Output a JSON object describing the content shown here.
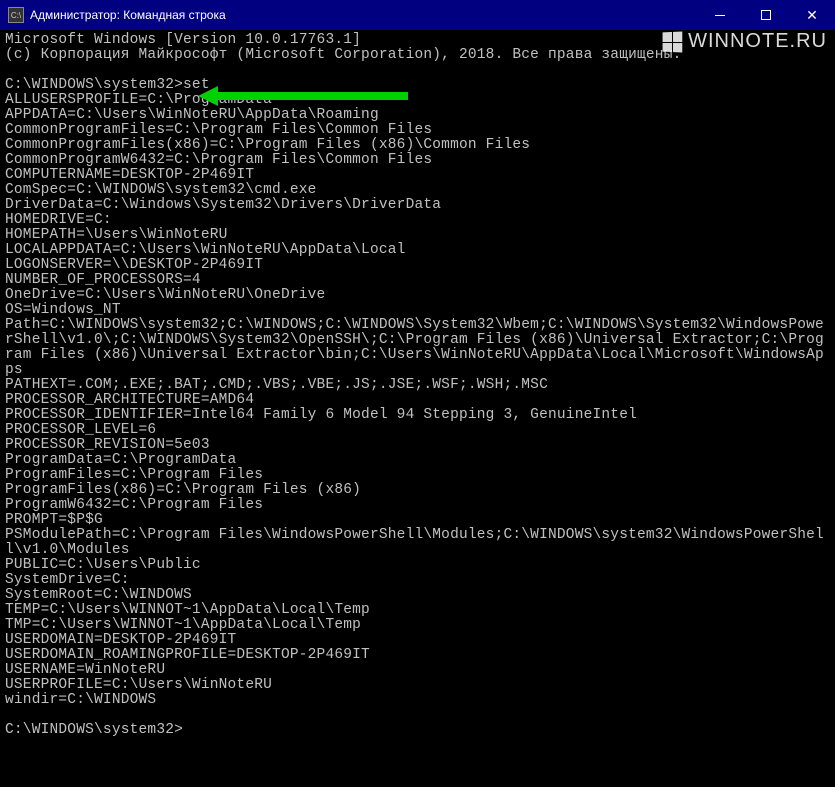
{
  "titlebar": {
    "icon_text": "C:\\",
    "title": "Администратор: Командная строка"
  },
  "watermark": {
    "text": "WINNOTE.RU"
  },
  "console": {
    "header1": "Microsoft Windows [Version 10.0.17763.1]",
    "header2": "(c) Корпорация Майкрософт (Microsoft Corporation), 2018. Все права защищены.",
    "prompt1_path": "C:\\WINDOWS\\system32>",
    "prompt1_cmd": "set",
    "env": [
      "ALLUSERSPROFILE=C:\\ProgramData",
      "APPDATA=C:\\Users\\WinNoteRU\\AppData\\Roaming",
      "CommonProgramFiles=C:\\Program Files\\Common Files",
      "CommonProgramFiles(x86)=C:\\Program Files (x86)\\Common Files",
      "CommonProgramW6432=C:\\Program Files\\Common Files",
      "COMPUTERNAME=DESKTOP-2P469IT",
      "ComSpec=C:\\WINDOWS\\system32\\cmd.exe",
      "DriverData=C:\\Windows\\System32\\Drivers\\DriverData",
      "HOMEDRIVE=C:",
      "HOMEPATH=\\Users\\WinNoteRU",
      "LOCALAPPDATA=C:\\Users\\WinNoteRU\\AppData\\Local",
      "LOGONSERVER=\\\\DESKTOP-2P469IT",
      "NUMBER_OF_PROCESSORS=4",
      "OneDrive=C:\\Users\\WinNoteRU\\OneDrive",
      "OS=Windows_NT",
      "Path=C:\\WINDOWS\\system32;C:\\WINDOWS;C:\\WINDOWS\\System32\\Wbem;C:\\WINDOWS\\System32\\WindowsPowerShell\\v1.0\\;C:\\WINDOWS\\System32\\OpenSSH\\;C:\\Program Files (x86)\\Universal Extractor;C:\\Program Files (x86)\\Universal Extractor\\bin;C:\\Users\\WinNoteRU\\AppData\\Local\\Microsoft\\WindowsApps",
      "PATHEXT=.COM;.EXE;.BAT;.CMD;.VBS;.VBE;.JS;.JSE;.WSF;.WSH;.MSC",
      "PROCESSOR_ARCHITECTURE=AMD64",
      "PROCESSOR_IDENTIFIER=Intel64 Family 6 Model 94 Stepping 3, GenuineIntel",
      "PROCESSOR_LEVEL=6",
      "PROCESSOR_REVISION=5e03",
      "ProgramData=C:\\ProgramData",
      "ProgramFiles=C:\\Program Files",
      "ProgramFiles(x86)=C:\\Program Files (x86)",
      "ProgramW6432=C:\\Program Files",
      "PROMPT=$P$G",
      "PSModulePath=C:\\Program Files\\WindowsPowerShell\\Modules;C:\\WINDOWS\\system32\\WindowsPowerShell\\v1.0\\Modules",
      "PUBLIC=C:\\Users\\Public",
      "SystemDrive=C:",
      "SystemRoot=C:\\WINDOWS",
      "TEMP=C:\\Users\\WINNOT~1\\AppData\\Local\\Temp",
      "TMP=C:\\Users\\WINNOT~1\\AppData\\Local\\Temp",
      "USERDOMAIN=DESKTOP-2P469IT",
      "USERDOMAIN_ROAMINGPROFILE=DESKTOP-2P469IT",
      "USERNAME=WinNoteRU",
      "USERPROFILE=C:\\Users\\WinNoteRU",
      "windir=C:\\WINDOWS"
    ],
    "prompt2": "C:\\WINDOWS\\system32>"
  }
}
